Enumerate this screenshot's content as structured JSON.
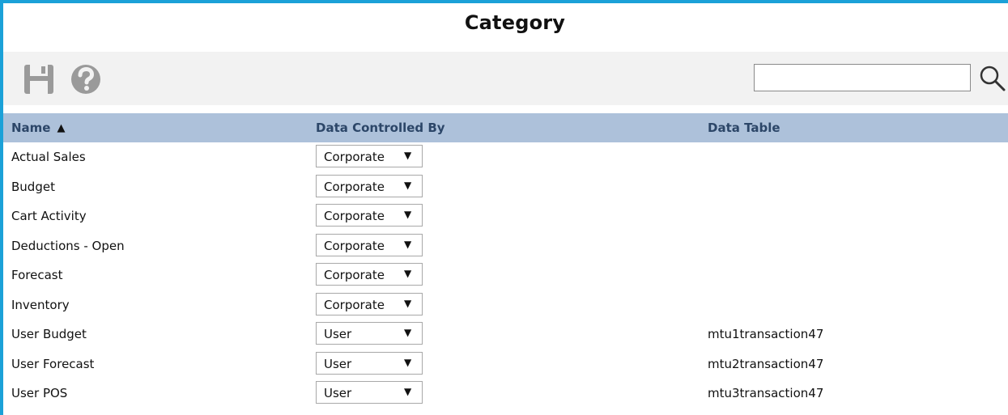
{
  "title": "Category",
  "toolbar": {
    "save_icon": "save-icon",
    "help_icon": "help-icon",
    "search_value": "",
    "search_icon": "search-icon"
  },
  "columns": {
    "name": "Name",
    "controlled_by": "Data Controlled By",
    "data_table": "Data Table",
    "sort_glyph": "▲"
  },
  "rows": [
    {
      "name": "Actual Sales",
      "controlled_by": "Corporate",
      "data_table": ""
    },
    {
      "name": "Budget",
      "controlled_by": "Corporate",
      "data_table": ""
    },
    {
      "name": "Cart Activity",
      "controlled_by": "Corporate",
      "data_table": ""
    },
    {
      "name": "Deductions - Open",
      "controlled_by": "Corporate",
      "data_table": ""
    },
    {
      "name": "Forecast",
      "controlled_by": "Corporate",
      "data_table": ""
    },
    {
      "name": "Inventory",
      "controlled_by": "Corporate",
      "data_table": ""
    },
    {
      "name": "User Budget",
      "controlled_by": "User",
      "data_table": "mtu1transaction47"
    },
    {
      "name": "User Forecast",
      "controlled_by": "User",
      "data_table": "mtu2transaction47"
    },
    {
      "name": "User POS",
      "controlled_by": "User",
      "data_table": "mtu3transaction47"
    }
  ],
  "dropdown_arrow": "▼",
  "colors": {
    "frame": "#1ba1d8",
    "header_bg": "#adc1da",
    "header_text": "#2c4668",
    "toolbar_bg": "#f2f2f2",
    "icon_gray": "#9a9a9a"
  }
}
